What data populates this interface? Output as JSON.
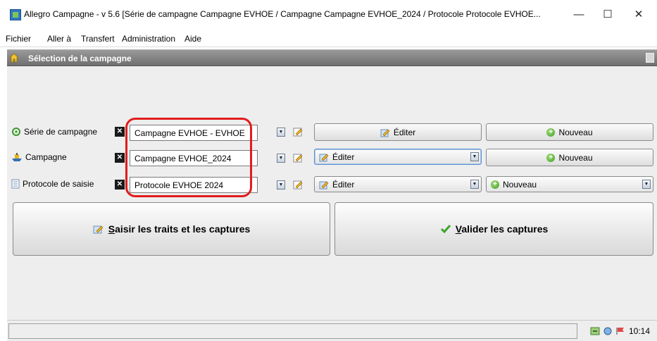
{
  "window": {
    "title": "Allegro Campagne - v 5.6 [Série de campagne Campagne EVHOE / Campagne Campagne EVHOE_2024 / Protocole Protocole EVHOE...",
    "minimize": "—",
    "maximize": "☐",
    "close": "✕"
  },
  "menu": {
    "items": [
      "Fichier",
      "Aller à",
      "Transfert",
      "Administration",
      "Aide"
    ]
  },
  "header": {
    "title": "Sélection de la campagne"
  },
  "rows": [
    {
      "label": "Série de campagne",
      "combo_value": "Campagne EVHOE - EVHOE",
      "edit_label": "Éditer",
      "new_label": "Nouveau"
    },
    {
      "label": "Campagne",
      "combo_value": "Campagne EVHOE_2024",
      "edit_label": "Éditer",
      "new_label": "Nouveau"
    },
    {
      "label": "Protocole de saisie",
      "combo_value": "Protocole EVHOE 2024",
      "edit_label": "Éditer",
      "new_label": "Nouveau"
    }
  ],
  "actions": {
    "capture_label_mnemonic": "S",
    "capture_label_rest": "aisir les traits et les captures",
    "validate_label_mnemonic": "V",
    "validate_label_rest": "alider les captures"
  },
  "status": {
    "clock": "10:14"
  },
  "colors": {
    "highlight": "#e31c1c",
    "header_bg": "#7f7f7f",
    "panel_bg": "#eeeeee"
  }
}
